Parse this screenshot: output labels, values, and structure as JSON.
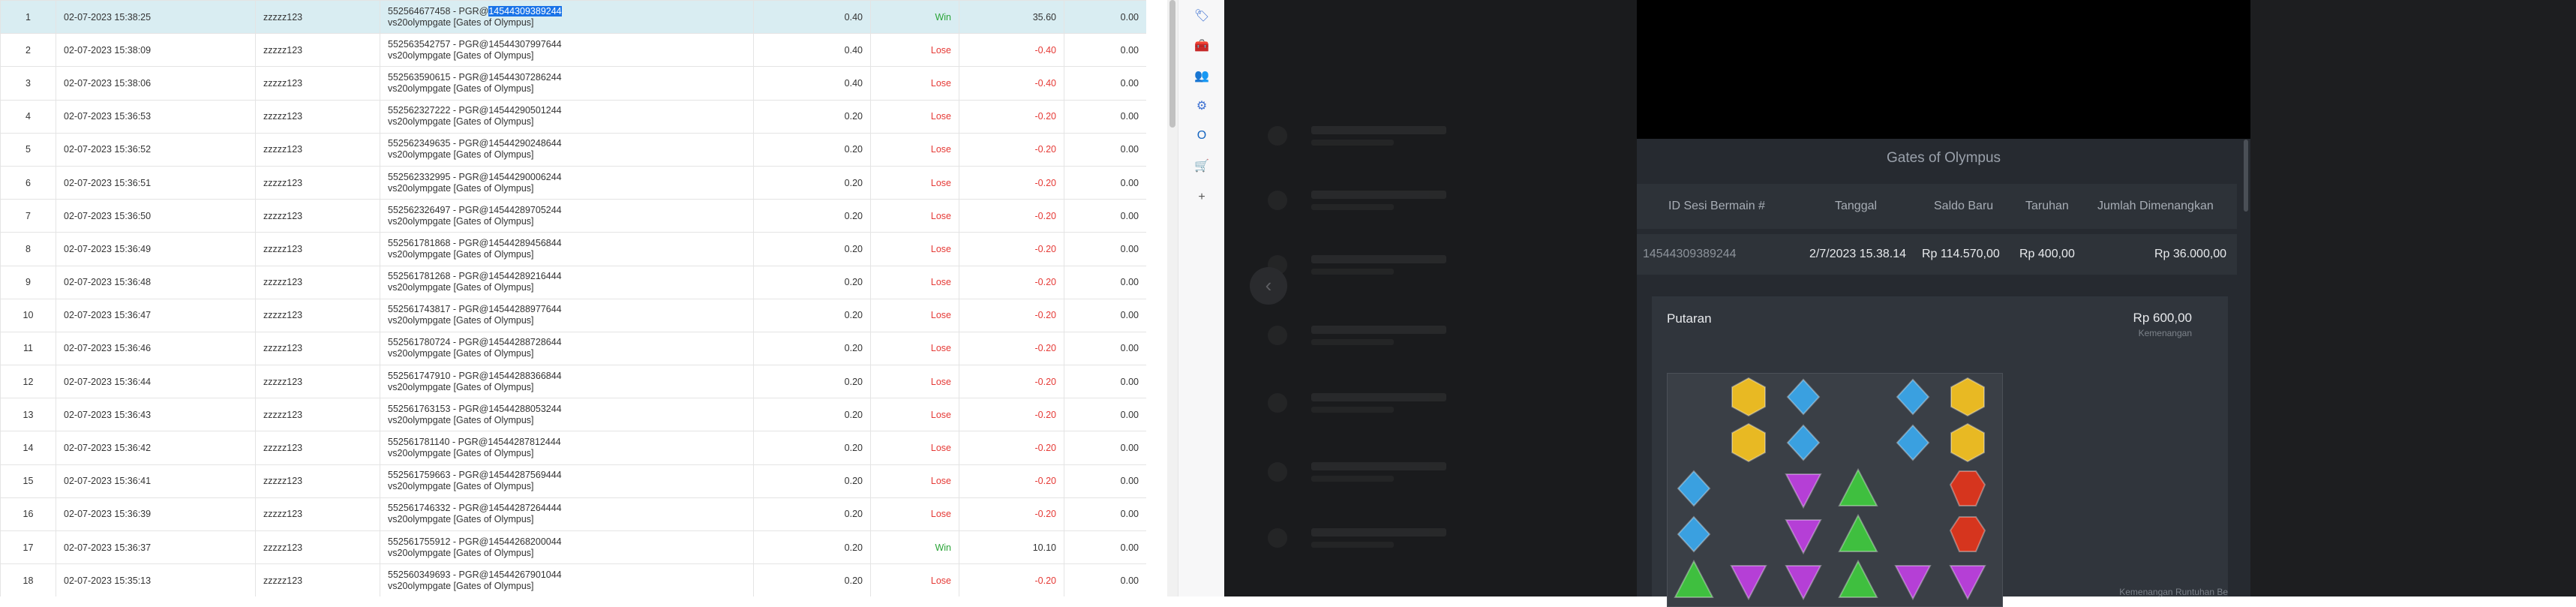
{
  "history": {
    "rows": [
      {
        "no": "1",
        "time": "02-07-2023 15:38:25",
        "user": "zzzzz123",
        "info_prefix": "552564677458 - PGR@",
        "info_id": "14544309389244",
        "info_game": "vs20olympgate [Gates of Olympus]",
        "bet": "0.40",
        "result": "Win",
        "result_type": "win",
        "winloss": "35.60",
        "winloss_type": "pos",
        "extra": "0.00",
        "selected": true
      },
      {
        "no": "2",
        "time": "02-07-2023 15:38:09",
        "user": "zzzzz123",
        "info_prefix": "552563542757 - PGR@",
        "info_id": "14544307997644",
        "info_game": "vs20olympgate [Gates of Olympus]",
        "bet": "0.40",
        "result": "Lose",
        "result_type": "lose",
        "winloss": "-0.40",
        "winloss_type": "neg",
        "extra": "0.00"
      },
      {
        "no": "3",
        "time": "02-07-2023 15:38:06",
        "user": "zzzzz123",
        "info_prefix": "552563590615 - PGR@",
        "info_id": "14544307286244",
        "info_game": "vs20olympgate [Gates of Olympus]",
        "bet": "0.40",
        "result": "Lose",
        "result_type": "lose",
        "winloss": "-0.40",
        "winloss_type": "neg",
        "extra": "0.00"
      },
      {
        "no": "4",
        "time": "02-07-2023 15:36:53",
        "user": "zzzzz123",
        "info_prefix": "552562327222 - PGR@",
        "info_id": "14544290501244",
        "info_game": "vs20olympgate [Gates of Olympus]",
        "bet": "0.20",
        "result": "Lose",
        "result_type": "lose",
        "winloss": "-0.20",
        "winloss_type": "neg",
        "extra": "0.00"
      },
      {
        "no": "5",
        "time": "02-07-2023 15:36:52",
        "user": "zzzzz123",
        "info_prefix": "552562349635 - PGR@",
        "info_id": "14544290248644",
        "info_game": "vs20olympgate [Gates of Olympus]",
        "bet": "0.20",
        "result": "Lose",
        "result_type": "lose",
        "winloss": "-0.20",
        "winloss_type": "neg",
        "extra": "0.00"
      },
      {
        "no": "6",
        "time": "02-07-2023 15:36:51",
        "user": "zzzzz123",
        "info_prefix": "552562332995 - PGR@",
        "info_id": "14544290006244",
        "info_game": "vs20olympgate [Gates of Olympus]",
        "bet": "0.20",
        "result": "Lose",
        "result_type": "lose",
        "winloss": "-0.20",
        "winloss_type": "neg",
        "extra": "0.00"
      },
      {
        "no": "7",
        "time": "02-07-2023 15:36:50",
        "user": "zzzzz123",
        "info_prefix": "552562326497 - PGR@",
        "info_id": "14544289705244",
        "info_game": "vs20olympgate [Gates of Olympus]",
        "bet": "0.20",
        "result": "Lose",
        "result_type": "lose",
        "winloss": "-0.20",
        "winloss_type": "neg",
        "extra": "0.00"
      },
      {
        "no": "8",
        "time": "02-07-2023 15:36:49",
        "user": "zzzzz123",
        "info_prefix": "552561781868 - PGR@",
        "info_id": "14544289456844",
        "info_game": "vs20olympgate [Gates of Olympus]",
        "bet": "0.20",
        "result": "Lose",
        "result_type": "lose",
        "winloss": "-0.20",
        "winloss_type": "neg",
        "extra": "0.00"
      },
      {
        "no": "9",
        "time": "02-07-2023 15:36:48",
        "user": "zzzzz123",
        "info_prefix": "552561781268 - PGR@",
        "info_id": "14544289216444",
        "info_game": "vs20olympgate [Gates of Olympus]",
        "bet": "0.20",
        "result": "Lose",
        "result_type": "lose",
        "winloss": "-0.20",
        "winloss_type": "neg",
        "extra": "0.00"
      },
      {
        "no": "10",
        "time": "02-07-2023 15:36:47",
        "user": "zzzzz123",
        "info_prefix": "552561743817 - PGR@",
        "info_id": "14544288977644",
        "info_game": "vs20olympgate [Gates of Olympus]",
        "bet": "0.20",
        "result": "Lose",
        "result_type": "lose",
        "winloss": "-0.20",
        "winloss_type": "neg",
        "extra": "0.00"
      },
      {
        "no": "11",
        "time": "02-07-2023 15:36:46",
        "user": "zzzzz123",
        "info_prefix": "552561780724 - PGR@",
        "info_id": "14544288728644",
        "info_game": "vs20olympgate [Gates of Olympus]",
        "bet": "0.20",
        "result": "Lose",
        "result_type": "lose",
        "winloss": "-0.20",
        "winloss_type": "neg",
        "extra": "0.00"
      },
      {
        "no": "12",
        "time": "02-07-2023 15:36:44",
        "user": "zzzzz123",
        "info_prefix": "552561747910 - PGR@",
        "info_id": "14544288366844",
        "info_game": "vs20olympgate [Gates of Olympus]",
        "bet": "0.20",
        "result": "Lose",
        "result_type": "lose",
        "winloss": "-0.20",
        "winloss_type": "neg",
        "extra": "0.00"
      },
      {
        "no": "13",
        "time": "02-07-2023 15:36:43",
        "user": "zzzzz123",
        "info_prefix": "552561763153 - PGR@",
        "info_id": "14544288053244",
        "info_game": "vs20olympgate [Gates of Olympus]",
        "bet": "0.20",
        "result": "Lose",
        "result_type": "lose",
        "winloss": "-0.20",
        "winloss_type": "neg",
        "extra": "0.00"
      },
      {
        "no": "14",
        "time": "02-07-2023 15:36:42",
        "user": "zzzzz123",
        "info_prefix": "552561781140 - PGR@",
        "info_id": "14544287812444",
        "info_game": "vs20olympgate [Gates of Olympus]",
        "bet": "0.20",
        "result": "Lose",
        "result_type": "lose",
        "winloss": "-0.20",
        "winloss_type": "neg",
        "extra": "0.00"
      },
      {
        "no": "15",
        "time": "02-07-2023 15:36:41",
        "user": "zzzzz123",
        "info_prefix": "552561759663 - PGR@",
        "info_id": "14544287569444",
        "info_game": "vs20olympgate [Gates of Olympus]",
        "bet": "0.20",
        "result": "Lose",
        "result_type": "lose",
        "winloss": "-0.20",
        "winloss_type": "neg",
        "extra": "0.00"
      },
      {
        "no": "16",
        "time": "02-07-2023 15:36:39",
        "user": "zzzzz123",
        "info_prefix": "552561746332 - PGR@",
        "info_id": "14544287264444",
        "info_game": "vs20olympgate [Gates of Olympus]",
        "bet": "0.20",
        "result": "Lose",
        "result_type": "lose",
        "winloss": "-0.20",
        "winloss_type": "neg",
        "extra": "0.00"
      },
      {
        "no": "17",
        "time": "02-07-2023 15:36:37",
        "user": "zzzzz123",
        "info_prefix": "552561755912 - PGR@",
        "info_id": "14544268200044",
        "info_game": "vs20olympgate [Gates of Olympus]",
        "bet": "0.20",
        "result": "Win",
        "result_type": "win",
        "winloss": "10.10",
        "winloss_type": "pos",
        "extra": "0.00"
      },
      {
        "no": "18",
        "time": "02-07-2023 15:35:13",
        "user": "zzzzz123",
        "info_prefix": "552560349693 - PGR@",
        "info_id": "14544267901044",
        "info_game": "vs20olympgate [Gates of Olympus]",
        "bet": "0.20",
        "result": "Lose",
        "result_type": "lose",
        "winloss": "-0.20",
        "winloss_type": "neg",
        "extra": "0.00"
      }
    ]
  },
  "sidebar": {
    "icons": [
      {
        "name": "tag-icon",
        "glyph": "🏷",
        "color": "#3b6fd1"
      },
      {
        "name": "toolbox-icon",
        "glyph": "🧰",
        "color": "#d14b3b"
      },
      {
        "name": "people-icon",
        "glyph": "👥",
        "color": "#7b3bd1"
      },
      {
        "name": "settings-icon",
        "glyph": "⚙",
        "color": "#3b6fd1"
      },
      {
        "name": "outlook-icon",
        "glyph": "O",
        "color": "#1565c0"
      },
      {
        "name": "shopping-cart-icon",
        "glyph": "🛒",
        "color": "#1aa3a3"
      },
      {
        "name": "add-icon",
        "glyph": "+",
        "color": "#555555"
      }
    ]
  },
  "modal": {
    "title": "Gates of Olympus",
    "headers": {
      "session_id": "ID Sesi Bermain #",
      "date": "Tanggal",
      "balance": "Saldo Baru",
      "bet": "Taruhan",
      "total_win": "Jumlah Dimenangkan"
    },
    "row": {
      "session_id": "14544309389244",
      "date": "2/7/2023 15.38.14",
      "balance": "Rp 114.570,00",
      "bet": "Rp 400,00",
      "total_win": "Rp 36.000,00"
    },
    "round": {
      "label": "Putaran",
      "amount": "Rp 600,00",
      "caption": "Kemenangan"
    },
    "footer_caption": "Kemenangan Runtuhan Be",
    "gem_colors": {
      "gold": "#e8b923",
      "blue": "#3aa0e0",
      "purple": "#b53fd6",
      "green": "#3fbf3f",
      "red": "#d6351e"
    }
  }
}
